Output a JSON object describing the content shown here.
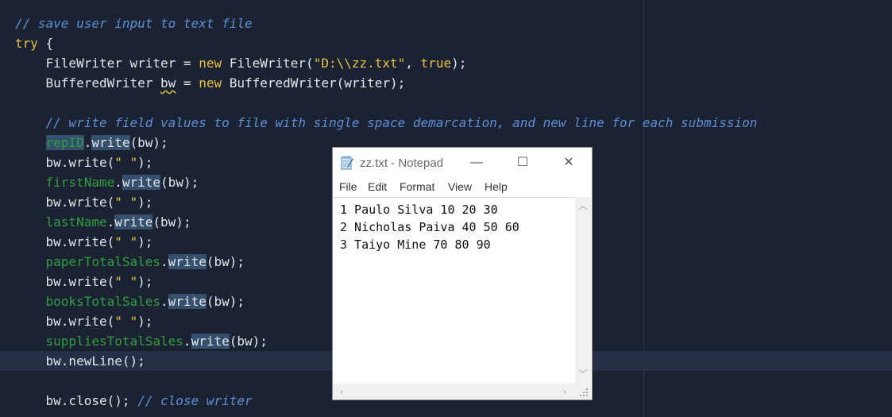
{
  "editor": {
    "lines": [
      {
        "parts": [
          {
            "t": "// save user input to text file",
            "c": "cm"
          }
        ]
      },
      {
        "parts": [
          {
            "t": "try",
            "c": "kw"
          },
          {
            "t": " {",
            "c": ""
          }
        ]
      },
      {
        "parts": [
          {
            "t": "    FileWriter writer = ",
            "c": ""
          },
          {
            "t": "new",
            "c": "kw"
          },
          {
            "t": " FileWriter(",
            "c": ""
          },
          {
            "t": "\"D:\\\\zz.txt\"",
            "c": "str"
          },
          {
            "t": ", ",
            "c": ""
          },
          {
            "t": "true",
            "c": "kw"
          },
          {
            "t": ");",
            "c": ""
          }
        ]
      },
      {
        "parts": [
          {
            "t": "    BufferedWriter ",
            "c": ""
          },
          {
            "t": "bw",
            "c": "sq"
          },
          {
            "t": " = ",
            "c": ""
          },
          {
            "t": "new",
            "c": "kw"
          },
          {
            "t": " BufferedWriter(writer);",
            "c": ""
          }
        ]
      },
      {
        "parts": []
      },
      {
        "parts": [
          {
            "t": "    // write field values to file with single space demarcation, and new line for each submission",
            "c": "cm"
          }
        ]
      },
      {
        "parts": [
          {
            "t": "    ",
            "c": ""
          },
          {
            "t": "repID",
            "c": "fld hl"
          },
          {
            "t": ".",
            "c": ""
          },
          {
            "t": "write",
            "c": "hl"
          },
          {
            "t": "(bw);",
            "c": ""
          }
        ]
      },
      {
        "parts": [
          {
            "t": "    bw.write(",
            "c": ""
          },
          {
            "t": "\" \"",
            "c": "str"
          },
          {
            "t": ");",
            "c": ""
          }
        ]
      },
      {
        "parts": [
          {
            "t": "    ",
            "c": ""
          },
          {
            "t": "firstName",
            "c": "fld"
          },
          {
            "t": ".",
            "c": ""
          },
          {
            "t": "write",
            "c": "hl"
          },
          {
            "t": "(bw);",
            "c": ""
          }
        ]
      },
      {
        "parts": [
          {
            "t": "    bw.write(",
            "c": ""
          },
          {
            "t": "\" \"",
            "c": "str"
          },
          {
            "t": ");",
            "c": ""
          }
        ]
      },
      {
        "parts": [
          {
            "t": "    ",
            "c": ""
          },
          {
            "t": "lastName",
            "c": "fld"
          },
          {
            "t": ".",
            "c": ""
          },
          {
            "t": "write",
            "c": "hl"
          },
          {
            "t": "(bw);",
            "c": ""
          }
        ]
      },
      {
        "parts": [
          {
            "t": "    bw.write(",
            "c": ""
          },
          {
            "t": "\" \"",
            "c": "str"
          },
          {
            "t": ");",
            "c": ""
          }
        ]
      },
      {
        "parts": [
          {
            "t": "    ",
            "c": ""
          },
          {
            "t": "paperTotalSales",
            "c": "fld"
          },
          {
            "t": ".",
            "c": ""
          },
          {
            "t": "write",
            "c": "hl"
          },
          {
            "t": "(bw);",
            "c": ""
          }
        ]
      },
      {
        "parts": [
          {
            "t": "    bw.write(",
            "c": ""
          },
          {
            "t": "\" \"",
            "c": "str"
          },
          {
            "t": ");",
            "c": ""
          }
        ]
      },
      {
        "parts": [
          {
            "t": "    ",
            "c": ""
          },
          {
            "t": "booksTotalSales",
            "c": "fld"
          },
          {
            "t": ".",
            "c": ""
          },
          {
            "t": "write",
            "c": "hl"
          },
          {
            "t": "(bw);",
            "c": ""
          }
        ]
      },
      {
        "parts": [
          {
            "t": "    bw.write(",
            "c": ""
          },
          {
            "t": "\" \"",
            "c": "str"
          },
          {
            "t": ");",
            "c": ""
          }
        ]
      },
      {
        "parts": [
          {
            "t": "    ",
            "c": ""
          },
          {
            "t": "suppliesTotalSales",
            "c": "fld"
          },
          {
            "t": ".",
            "c": ""
          },
          {
            "t": "write",
            "c": "hl"
          },
          {
            "t": "(bw);",
            "c": ""
          }
        ]
      },
      {
        "parts": [
          {
            "t": "    bw.newLine();",
            "c": ""
          }
        ],
        "current": true
      },
      {
        "parts": []
      },
      {
        "parts": [
          {
            "t": "    bw.close(); ",
            "c": ""
          },
          {
            "t": "// close writer",
            "c": "cm"
          }
        ]
      }
    ]
  },
  "notepad": {
    "title": "zz.txt - Notepad",
    "icon": "notepad-icon",
    "menu": [
      "File",
      "Edit",
      "Format",
      "View",
      "Help"
    ],
    "content": [
      "1 Paulo Silva 10 20 30",
      "2 Nicholas Paiva 40 50 60",
      "3 Taiyo Mine 70 80 90"
    ],
    "minimize_glyph": "—",
    "maximize_glyph": "☐",
    "close_glyph": "✕"
  }
}
